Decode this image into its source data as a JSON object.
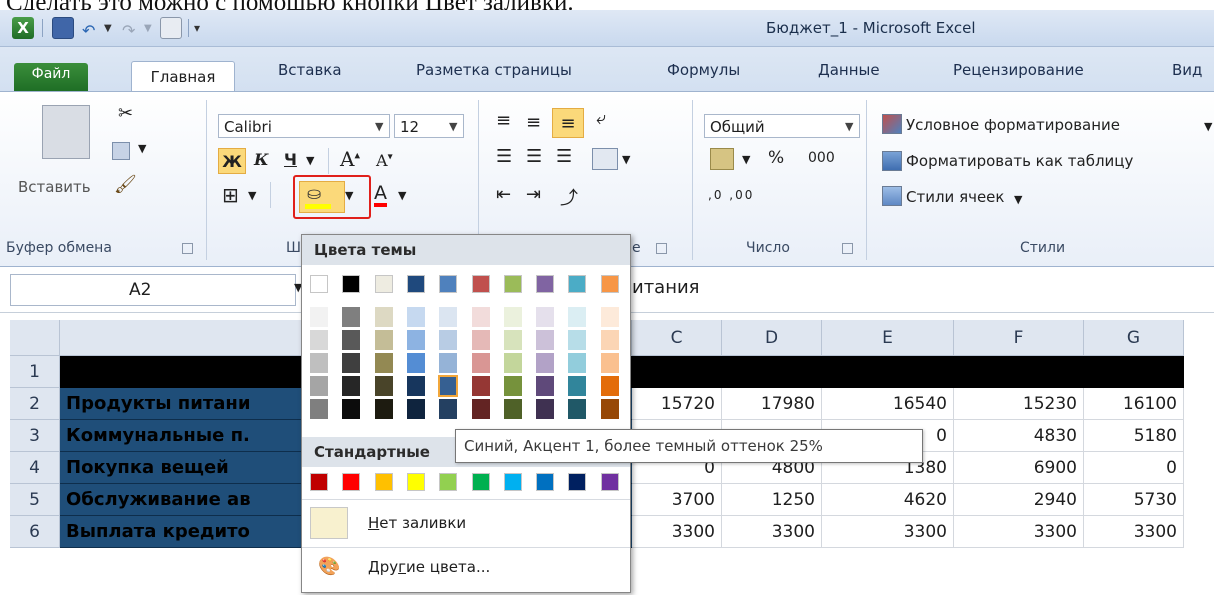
{
  "caption": "Сделать это можно с помощью кнопки Цвет заливки.",
  "window": {
    "title": "Бюджет_1  -  Microsoft Excel"
  },
  "tabs": [
    "Файл",
    "Главная",
    "Вставка",
    "Разметка страницы",
    "Формулы",
    "Данные",
    "Рецензирование",
    "Вид"
  ],
  "ribbon": {
    "clipboard": {
      "paste": "Вставить",
      "label": "Буфер обмена"
    },
    "font": {
      "name": "Calibri",
      "size": "12",
      "bold": "Ж",
      "italic": "К",
      "underline": "Ч",
      "grow": "A",
      "shrink": "A",
      "fontcolor": "A",
      "label_start": "Ш"
    },
    "alignment": {
      "label_end": "е"
    },
    "number": {
      "format": "Общий",
      "percent": "%",
      "thousands": "000",
      "inc_dec": ",0 ,00",
      "label": "Число"
    },
    "styles": {
      "conditional": "Условное форматирование",
      "as_table": "Форматировать как таблицу",
      "cell_styles": "Стили ячеек",
      "label": "Стили"
    }
  },
  "formula_bar": {
    "name_box": "A2",
    "formula_fragment": "итания"
  },
  "grid": {
    "columns": [
      "A",
      "C",
      "D",
      "E",
      "F",
      "G"
    ],
    "rows": [
      {
        "n": "1",
        "label": "",
        "values": [
          "",
          "",
          "",
          "",
          ""
        ]
      },
      {
        "n": "2",
        "label": "Продукты питани",
        "values": [
          "15720",
          "17980",
          "16540",
          "15230",
          "16100"
        ]
      },
      {
        "n": "3",
        "label": "Коммунальные п.",
        "values": [
          "",
          "",
          "0",
          "4830",
          "5180"
        ]
      },
      {
        "n": "4",
        "label": "Покупка вещей",
        "values": [
          "0",
          "4800",
          "1380",
          "6900",
          "0"
        ]
      },
      {
        "n": "5",
        "label": "Обслуживание ав",
        "values": [
          "3700",
          "1250",
          "4620",
          "2940",
          "5730"
        ]
      },
      {
        "n": "6",
        "label": "Выплата кредито",
        "values": [
          "3300",
          "3300",
          "3300",
          "3300",
          "3300"
        ]
      }
    ]
  },
  "fill_menu": {
    "theme_header": "Цвета темы",
    "standard_header": "Стандартные",
    "no_fill": "Нет заливки",
    "no_fill_mnemonic": "Н",
    "more_colors": "Другие цвета...",
    "more_colors_mnemonic": "г",
    "tooltip": "Синий, Акцент 1, более темный оттенок 25%",
    "theme_top": [
      "#ffffff",
      "#000000",
      "#eeece1",
      "#1f497d",
      "#4f81bd",
      "#c0504d",
      "#9bbb59",
      "#8064a2",
      "#4bacc6",
      "#f79646"
    ],
    "theme_shades": [
      [
        "#f2f2f2",
        "#7f7f7f",
        "#ddd9c3",
        "#c6d9f0",
        "#dbe5f1",
        "#f2dcdb",
        "#ebf1dd",
        "#e5e0ec",
        "#dbeef3",
        "#fdeada"
      ],
      [
        "#d8d8d8",
        "#595959",
        "#c4bd97",
        "#8db3e2",
        "#b8cce4",
        "#e5b9b7",
        "#d7e3bc",
        "#ccc1d9",
        "#b7dde8",
        "#fbd5b5"
      ],
      [
        "#bfbfbf",
        "#3f3f3f",
        "#938953",
        "#548dd4",
        "#95b3d7",
        "#d99694",
        "#c3d69b",
        "#b2a2c7",
        "#92cddc",
        "#fac08f"
      ],
      [
        "#a5a5a5",
        "#262626",
        "#494429",
        "#17365d",
        "#366092",
        "#953734",
        "#76923c",
        "#5f497a",
        "#31859b",
        "#e36c09"
      ],
      [
        "#7f7f7f",
        "#0c0c0c",
        "#1d1b10",
        "#0f243e",
        "#244061",
        "#632423",
        "#4f6128",
        "#3f3151",
        "#205867",
        "#974806"
      ]
    ],
    "standard": [
      "#c00000",
      "#ff0000",
      "#ffc000",
      "#ffff00",
      "#92d050",
      "#00b050",
      "#00b0f0",
      "#0070c0",
      "#002060",
      "#7030a0"
    ]
  }
}
